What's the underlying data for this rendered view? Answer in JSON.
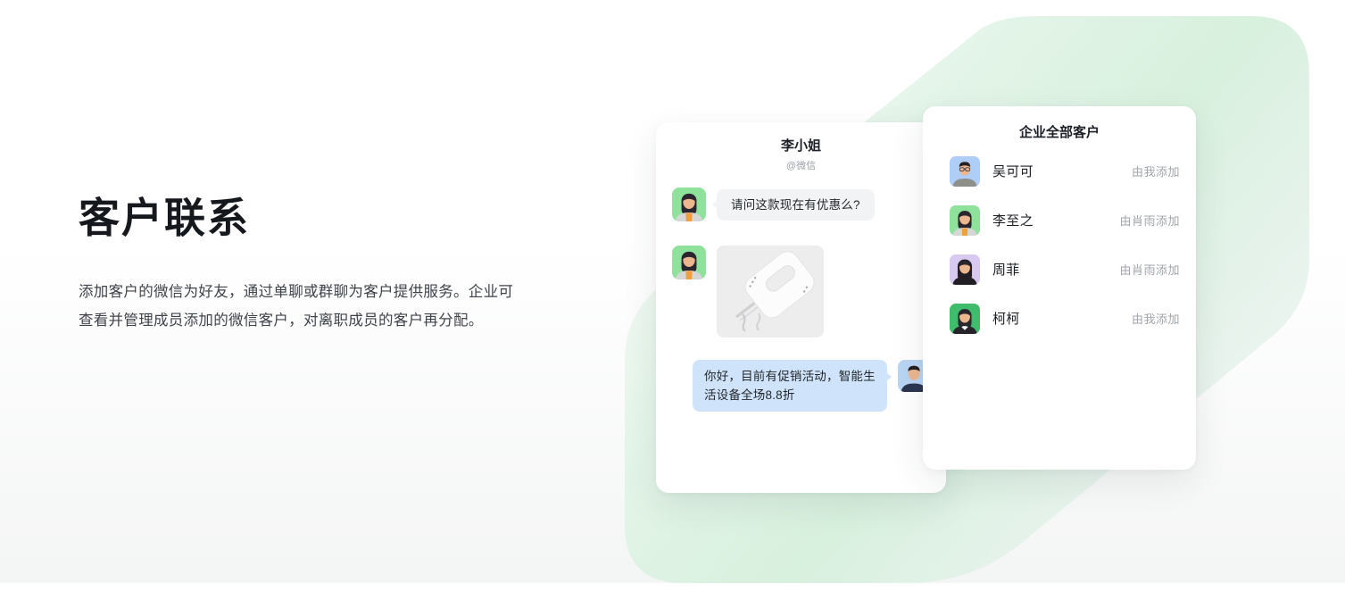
{
  "intro": {
    "heading": "客户联系",
    "description": "添加客户的微信为好友，通过单聊或群聊为客户提供服务。企业可查看并管理成员添加的微信客户，对离职成员的客户再分配。"
  },
  "chat_card": {
    "contact_name": "李小姐",
    "contact_source": "@微信",
    "incoming_message": "请问这款现在有优惠么?",
    "reply_message": "你好，目前有促销活动，智能生活设备全场8.8折",
    "customer_avatar": {
      "type": "woman-cardigan",
      "bg": "#8ee29b"
    },
    "staff_avatar": {
      "type": "man-navy",
      "bg": "#b9d5f4"
    }
  },
  "customer_card": {
    "title": "企业全部客户",
    "customers": [
      {
        "name": "吴可可",
        "added_by": "由我添加",
        "avatar": {
          "type": "man-glasses",
          "bg": "#aecdf7"
        }
      },
      {
        "name": "李至之",
        "added_by": "由肖雨添加",
        "avatar": {
          "type": "woman-cardigan",
          "bg": "#8ee29b"
        }
      },
      {
        "name": "周菲",
        "added_by": "由肖雨添加",
        "avatar": {
          "type": "woman-dark",
          "bg": "#d8c9f1"
        }
      },
      {
        "name": "柯柯",
        "added_by": "由我添加",
        "avatar": {
          "type": "woman-collar",
          "bg": "#3fbd6d"
        }
      }
    ]
  },
  "colors": {
    "accent_green_shape": "#ddf2e2",
    "incoming_bubble": "#f2f3f5",
    "reply_bubble": "#cfe4fb",
    "heading_text": "#15181c",
    "body_text": "#3f434a",
    "muted_text": "#9aa0a6"
  }
}
